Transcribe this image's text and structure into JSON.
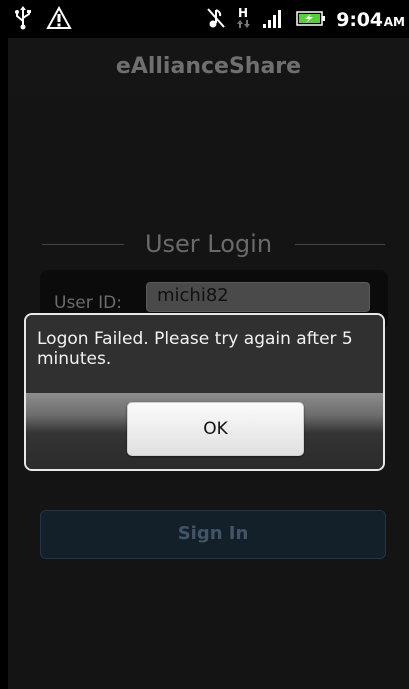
{
  "status_bar": {
    "time": "9:04",
    "ampm": "AM",
    "icons": [
      "usb-icon",
      "warning-icon",
      "mute-icon",
      "hsdpa-data-icon",
      "signal-bars-icon",
      "battery-charging-icon"
    ]
  },
  "app": {
    "title": "eAllianceShare"
  },
  "login": {
    "section_title": "User Login",
    "user_id_label": "User ID:",
    "user_id_value": "michi82",
    "sign_in_label": "Sign In"
  },
  "dialog": {
    "message": "Logon Failed. Please try again after 5 minutes.",
    "ok_label": "OK"
  },
  "colors": {
    "dialog_border": "#e8e8e8",
    "sign_in_background": "#142029",
    "battery_green": "#56d13a"
  }
}
